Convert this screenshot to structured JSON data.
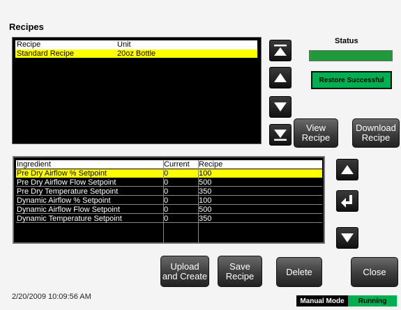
{
  "title": "Recipes",
  "recipe_list": {
    "header": {
      "recipe": "Recipe",
      "unit": "Unit"
    },
    "rows": [
      {
        "recipe": "Standard Recipe",
        "unit": "20oz Bottle",
        "selected": true
      }
    ]
  },
  "status": {
    "label": "Status",
    "message": "Restore Successful",
    "bar_color": "#1e9a3a"
  },
  "buttons": {
    "view_recipe": "View\nRecipe",
    "download_recipe": "Download\nRecipe",
    "upload_and_create": "Upload\nand Create",
    "save_recipe": "Save\nRecipe",
    "delete": "Delete",
    "close": "Close"
  },
  "icons": {
    "scroll_top": "double-up-arrow-icon",
    "scroll_up": "up-arrow-icon",
    "scroll_down": "down-arrow-icon",
    "scroll_bottom": "double-down-arrow-icon",
    "enter": "enter-icon"
  },
  "ingredients": {
    "columns": [
      "Ingredient",
      "Current",
      "Recipe"
    ],
    "rows": [
      {
        "ingredient": "Pre Dry Airflow % Setpoint",
        "current": "0",
        "recipe": "100"
      },
      {
        "ingredient": "Pre Dry Airflow Flow Setpoint",
        "current": "0",
        "recipe": "500"
      },
      {
        "ingredient": "Pre Dry Temperature Setpoint",
        "current": "0",
        "recipe": "350"
      },
      {
        "ingredient": "Dynamic Airflow % Setpoint",
        "current": "0",
        "recipe": "100"
      },
      {
        "ingredient": "Dynamic Airflow Flow Setpoint",
        "current": "0",
        "recipe": "500"
      },
      {
        "ingredient": "Dynamic Temperature Setpoint",
        "current": "0",
        "recipe": "350"
      }
    ]
  },
  "footer": {
    "timestamp": "2/20/2009 10:09:56 AM",
    "mode": "Manual Mode",
    "running": "Running"
  },
  "colors": {
    "selection": "#ffff00",
    "status_green": "#00b050"
  }
}
